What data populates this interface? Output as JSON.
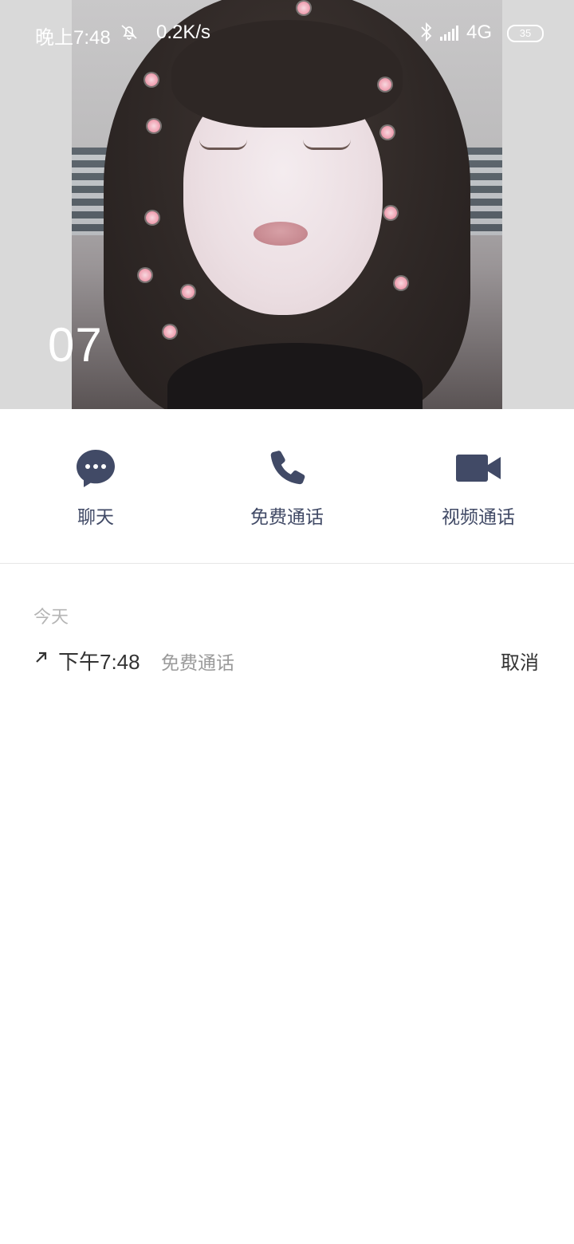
{
  "status_bar": {
    "time": "晚上7:48",
    "mute_icon": "bell-off-icon",
    "speed": "0.2K/s",
    "bluetooth_icon": "bluetooth-icon",
    "network": "4G",
    "battery": "35"
  },
  "contact": {
    "name": "07"
  },
  "actions": {
    "chat_label": "聊天",
    "call_label": "免费通话",
    "video_label": "视频通话"
  },
  "history": {
    "date_header": "今天",
    "entries": [
      {
        "time": "下午7:48",
        "type": "免费通话",
        "status": "取消"
      }
    ]
  },
  "colors": {
    "icon": "#414a66",
    "label": "#414a66",
    "muted": "#b5b5b5"
  }
}
